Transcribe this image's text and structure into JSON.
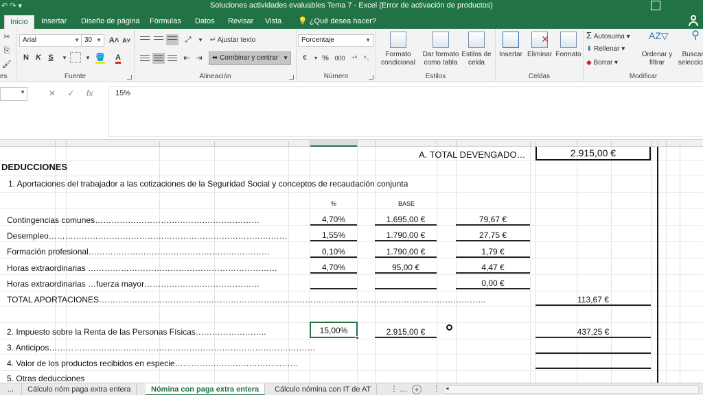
{
  "window": {
    "title": "Soluciones actividades evaluables Tema 7 - Excel (Error de activación de productos)"
  },
  "ribbon_tabs": [
    "Inicio",
    "Insertar",
    "Diseño de página",
    "Fórmulas",
    "Datos",
    "Revisar",
    "Vista"
  ],
  "tell_me": "¿Qué desea hacer?",
  "font": {
    "name": "Arial",
    "size": "30"
  },
  "font_buttons": {
    "bold": "N",
    "italic": "K",
    "underline": "S",
    "grow": "A",
    "shrink": "A"
  },
  "alignment": {
    "wrap_text": "Ajustar texto",
    "merge_center": "Combinar y centrar"
  },
  "number": {
    "format": "Porcentaje",
    "percent": "%",
    "thousands": "000",
    "accounting": "€"
  },
  "styles": {
    "conditional": [
      "Formato",
      "condicional"
    ],
    "as_table": [
      "Dar formato",
      "como tabla"
    ],
    "cell_styles": [
      "Estilos de",
      "celda"
    ]
  },
  "cells": {
    "insert": "Insertar",
    "delete": "Eliminar",
    "format": "Formato"
  },
  "editing": {
    "autosum": "Autosuma",
    "fill": "Rellenar",
    "clear": "Borrar",
    "sort": [
      "Ordenar y",
      "filtrar"
    ],
    "find": [
      "Buscar y",
      "seleccionar"
    ]
  },
  "group_labels": {
    "clipboard": "es",
    "font": "Fuente",
    "alignment": "Alineación",
    "number": "Número",
    "styles": "Estilos",
    "cells": "Celdas",
    "editing": "Modificar"
  },
  "formula_bar": {
    "cancel": "✕",
    "enter": "✓",
    "fx": "fx",
    "value": "15%"
  },
  "sheet": {
    "total_devengado_label": "A. TOTAL DEVENGADO…",
    "total_devengado_value": "2.915,00 €",
    "deducciones_title": "DEDUCCIONES",
    "section1_title": "1. Aportaciones del trabajador a las cotizaciones de la Seguridad Social y conceptos de recaudación conjunta",
    "col_percent": "%",
    "col_base": "BASE",
    "rows": [
      {
        "label": "Contingencias comunes……………………………………………………",
        "pct": "4,70%",
        "base": "1.695,00 €",
        "amount": "79,67 €"
      },
      {
        "label": "Desempleo……………………………………………………………………………",
        "pct": "1,55%",
        "base": "1.790,00 €",
        "amount": "27,75 €"
      },
      {
        "label": "Formación profesional…………………………………………………………",
        "pct": "0,10%",
        "base": "1.790,00 €",
        "amount": "1,79 €"
      },
      {
        "label": "Horas extraordinarias ……………………………………………………………",
        "pct": "4,70%",
        "base": "95,00 €",
        "amount": "4,47 €"
      },
      {
        "label": "Horas extraordinarias …fuerza mayor……………………………………",
        "pct": "",
        "base": "",
        "amount": "0,00 €"
      }
    ],
    "total_aportaciones_label": "TOTAL APORTACIONES……………………………………………………………………………………………………………………………",
    "total_aportaciones_value": "113,67 €",
    "irpf_label": "2. Impuesto sobre la Renta de las Personas Físicas……………………..",
    "irpf_pct": "15,00%",
    "irpf_base": "2.915,00 €",
    "irpf_amount": "437,25 €",
    "anticipos": "3. Anticipos…………………………………………………………………………………….",
    "especie": "4. Valor de los productos recibidos en especie………………………………………",
    "otras": "5. Otras deducciones"
  },
  "sheet_tabs": [
    "...",
    "Cálculo nóm  paga extra entera",
    "Nómina con paga extra entera",
    "Cálculo nómina con IT de AT"
  ],
  "active_sheet_index": 2
}
